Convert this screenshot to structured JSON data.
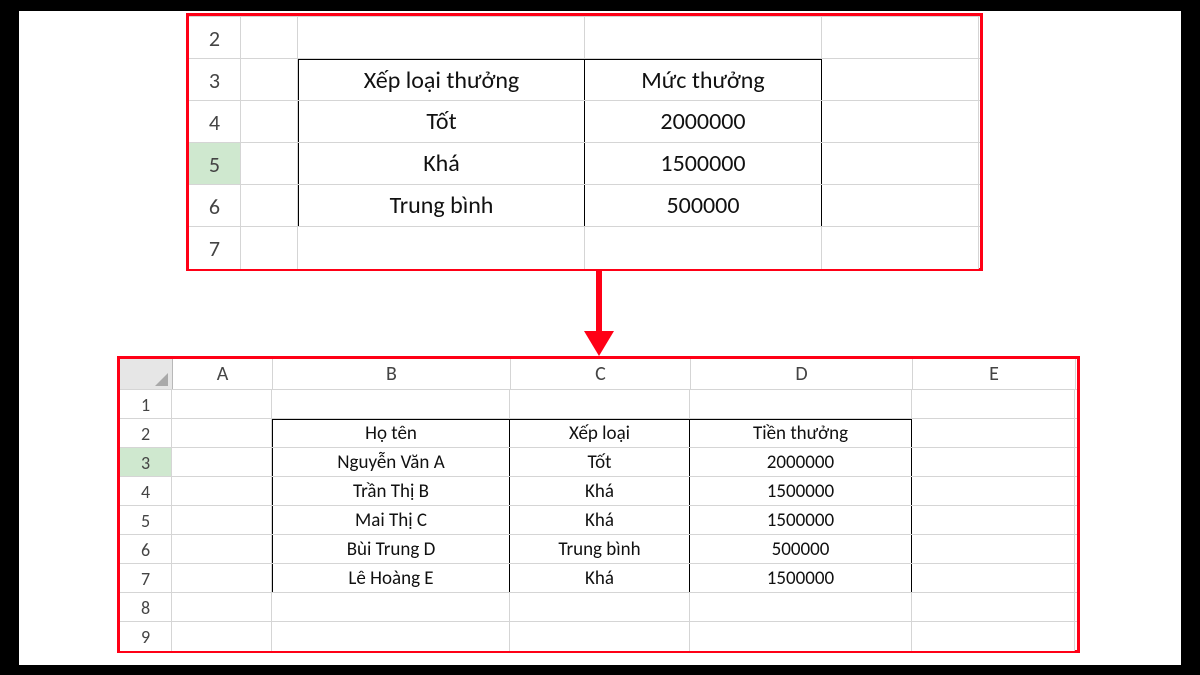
{
  "top_sheet": {
    "selected_row_header": "5",
    "row_headers": [
      "2",
      "3",
      "4",
      "5",
      "6",
      "7"
    ],
    "table": {
      "headers": {
        "col_b": "Xếp loại thưởng",
        "col_c": "Mức thưởng"
      },
      "rows": [
        {
          "b": "Tốt",
          "c": "2000000"
        },
        {
          "b": "Khá",
          "c": "1500000"
        },
        {
          "b": "Trung bình",
          "c": "500000"
        }
      ]
    }
  },
  "bottom_sheet": {
    "column_letters": [
      "A",
      "B",
      "C",
      "D",
      "E"
    ],
    "selected_row_header": "3",
    "row_headers": [
      "1",
      "2",
      "3",
      "4",
      "5",
      "6",
      "7",
      "8",
      "9"
    ],
    "table": {
      "headers": {
        "b": "Họ tên",
        "c": "Xếp loại",
        "d": "Tiền thưởng"
      },
      "rows": [
        {
          "b": "Nguyễn Văn A",
          "c": "Tốt",
          "d": "2000000"
        },
        {
          "b": "Trần Thị B",
          "c": "Khá",
          "d": "1500000"
        },
        {
          "b": "Mai Thị C",
          "c": "Khá",
          "d": "1500000"
        },
        {
          "b": "Bùi Trung D",
          "c": "Trung bình",
          "d": "500000"
        },
        {
          "b": "Lê Hoàng E",
          "c": "Khá",
          "d": "1500000"
        }
      ]
    }
  }
}
